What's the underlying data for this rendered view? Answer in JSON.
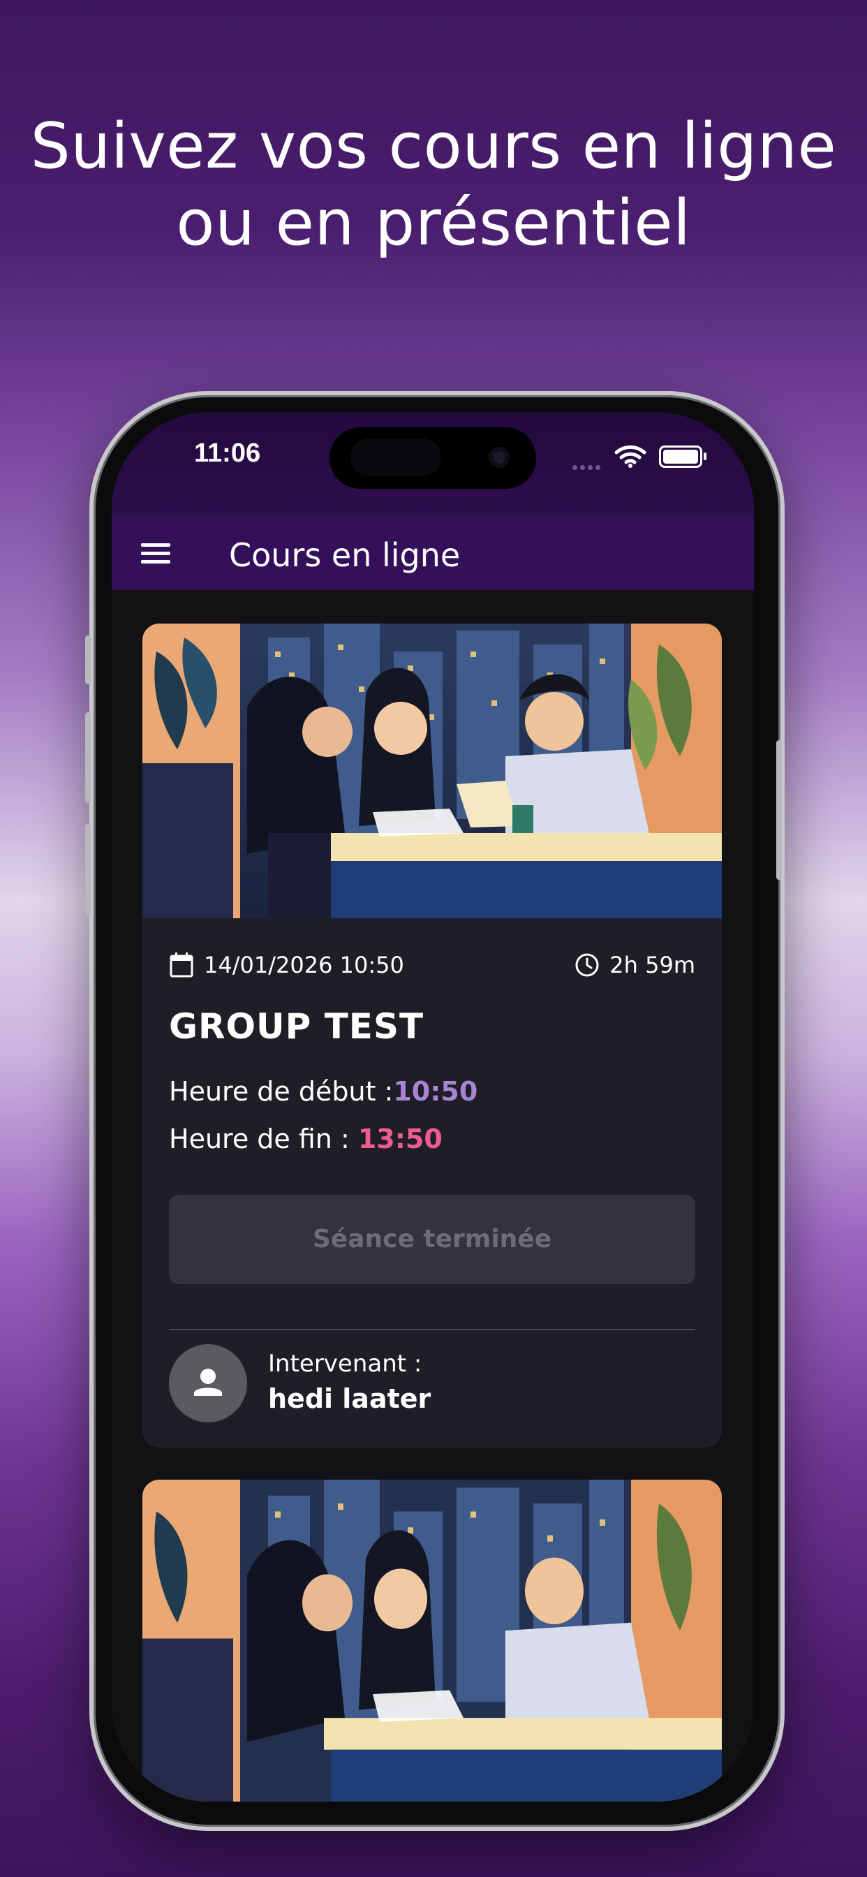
{
  "headline": {
    "line1": "Suivez vos cours en ligne",
    "line2": "ou en présentiel"
  },
  "status_bar": {
    "time": "11:06",
    "icons": [
      "cellular-icon",
      "wifi-icon",
      "battery-icon"
    ]
  },
  "app_bar": {
    "title": "Cours en ligne",
    "menu_icon": "hamburger-menu-icon"
  },
  "sessions": [
    {
      "date": "14/01/2026 10:50",
      "duration": "2h 59m",
      "title": "GROUP TEST",
      "start_label": "Heure de début :",
      "start_time": "10:50",
      "end_label": "Heure de fin : ",
      "end_time": "13:50",
      "status_button": "Séance terminée",
      "speaker_label": "Intervenant :",
      "speaker_name": "hedi laater"
    }
  ],
  "colors": {
    "app_bar": "#34105a",
    "start_time": "#a883d6",
    "end_time": "#ef5d8f",
    "card": "#1f1e26"
  }
}
